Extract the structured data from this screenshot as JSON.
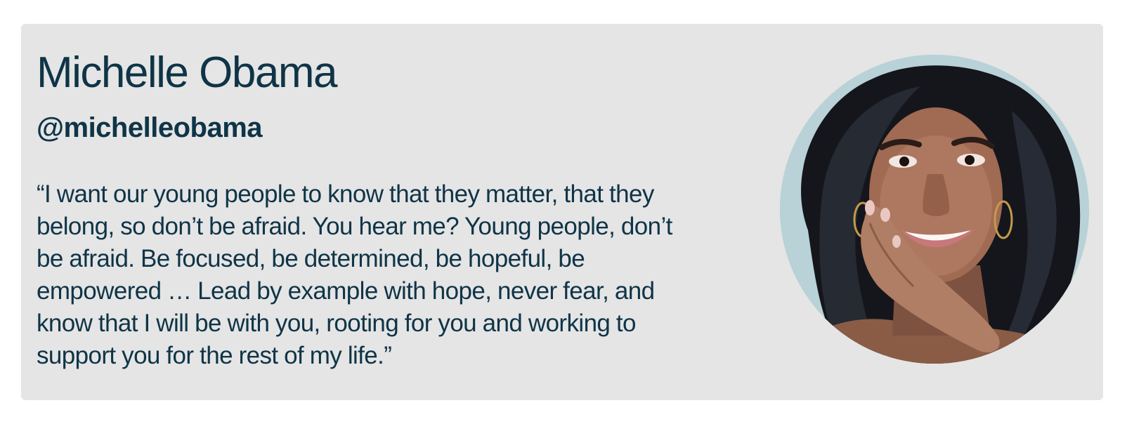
{
  "profile": {
    "name": "Michelle Obama",
    "handle": "@michelleobama",
    "quote": "“I want our young people to know that they matter, that they belong, so don’t be afraid. You hear me? Young people, don’t be afraid. Be focused, be determined, be hopeful, be empowered … Lead by example with hope, never fear, and know that I will be with you, rooting for you and working to support you for the rest of my life.”",
    "photo_icon": "portrait-photo"
  },
  "colors": {
    "card_background": "#e5e5e5",
    "text": "#0f3447",
    "page_background": "#ffffff"
  }
}
